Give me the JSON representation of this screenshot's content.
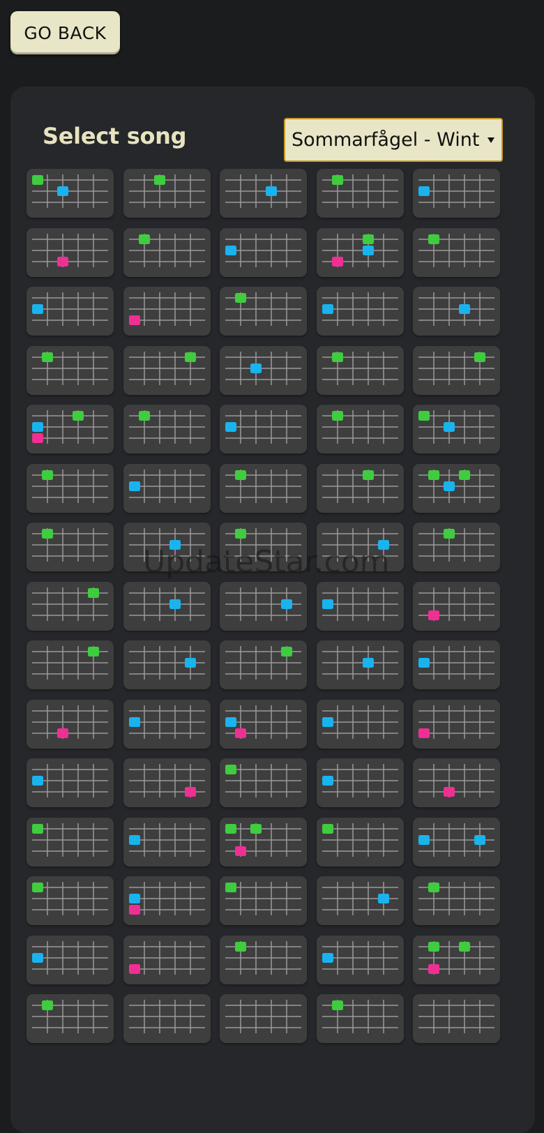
{
  "back_label": "GO BACK",
  "select_label": "Select song",
  "song_selected": "Sommarfågel - Wint",
  "watermark": "UpdateStar.com",
  "note_colors": {
    "g": "#3fcc3f",
    "b": "#19b3ee",
    "p": "#ef2f93"
  },
  "rows": [
    [
      [
        [
          "g",
          0,
          0
        ],
        [
          "b",
          2,
          1
        ]
      ],
      [
        [
          "g",
          2,
          0
        ]
      ],
      [
        [
          "b",
          3,
          1
        ]
      ],
      [
        [
          "g",
          1,
          0
        ]
      ],
      [
        [
          "b",
          0,
          1
        ]
      ]
    ],
    [
      [
        [
          "p",
          2,
          2
        ]
      ],
      [
        [
          "g",
          1,
          0
        ]
      ],
      [
        [
          "b",
          0,
          1
        ]
      ],
      [
        [
          "g",
          3,
          0
        ],
        [
          "b",
          3,
          1
        ],
        [
          "p",
          1,
          2
        ]
      ],
      [
        [
          "g",
          1,
          0
        ]
      ]
    ],
    [
      [
        [
          "b",
          0,
          1
        ]
      ],
      [
        [
          "p",
          0,
          2
        ]
      ],
      [
        [
          "g",
          1,
          0
        ]
      ],
      [
        [
          "b",
          0,
          1
        ]
      ],
      [
        [
          "b",
          3,
          1
        ]
      ]
    ],
    [
      [
        [
          "g",
          1,
          0
        ]
      ],
      [
        [
          "g",
          4,
          0
        ]
      ],
      [
        [
          "b",
          2,
          1
        ]
      ],
      [
        [
          "g",
          1,
          0
        ]
      ],
      [
        [
          "g",
          4,
          0
        ]
      ]
    ],
    [
      [
        [
          "g",
          3,
          0
        ],
        [
          "b",
          0,
          1
        ],
        [
          "p",
          0,
          2
        ]
      ],
      [
        [
          "g",
          1,
          0
        ]
      ],
      [
        [
          "b",
          0,
          1
        ]
      ],
      [
        [
          "g",
          1,
          0
        ]
      ],
      [
        [
          "g",
          0,
          0
        ],
        [
          "b",
          2,
          1
        ]
      ]
    ],
    [
      [
        [
          "g",
          1,
          0
        ]
      ],
      [
        [
          "b",
          0,
          1
        ]
      ],
      [
        [
          "g",
          1,
          0
        ]
      ],
      [
        [
          "g",
          3,
          0
        ]
      ],
      [
        [
          "g",
          1,
          0
        ],
        [
          "g",
          3,
          0
        ],
        [
          "b",
          2,
          1
        ]
      ]
    ],
    [
      [
        [
          "g",
          1,
          0
        ]
      ],
      [
        [
          "b",
          3,
          1
        ]
      ],
      [
        [
          "g",
          1,
          0
        ]
      ],
      [
        [
          "b",
          4,
          1
        ]
      ],
      [
        [
          "g",
          2,
          0
        ]
      ]
    ],
    [
      [
        [
          "g",
          4,
          0
        ]
      ],
      [
        [
          "b",
          3,
          1
        ]
      ],
      [
        [
          "b",
          4,
          1
        ]
      ],
      [
        [
          "b",
          0,
          1
        ]
      ],
      [
        [
          "p",
          1,
          2
        ]
      ]
    ],
    [
      [
        [
          "g",
          4,
          0
        ]
      ],
      [
        [
          "b",
          4,
          1
        ]
      ],
      [
        [
          "g",
          4,
          0
        ]
      ],
      [
        [
          "b",
          3,
          1
        ]
      ],
      [
        [
          "b",
          0,
          1
        ]
      ]
    ],
    [
      [
        [
          "p",
          2,
          2
        ]
      ],
      [
        [
          "b",
          0,
          1
        ]
      ],
      [
        [
          "b",
          0,
          1
        ],
        [
          "p",
          1,
          2
        ]
      ],
      [
        [
          "b",
          0,
          1
        ]
      ],
      [
        [
          "p",
          0,
          2
        ]
      ]
    ],
    [
      [
        [
          "b",
          0,
          1
        ]
      ],
      [
        [
          "p",
          4,
          2
        ]
      ],
      [
        [
          "g",
          0,
          0
        ]
      ],
      [
        [
          "b",
          0,
          1
        ]
      ],
      [
        [
          "p",
          2,
          2
        ]
      ]
    ],
    [
      [
        [
          "g",
          0,
          0
        ]
      ],
      [
        [
          "b",
          0,
          1
        ]
      ],
      [
        [
          "g",
          0,
          0
        ],
        [
          "g",
          2,
          0
        ],
        [
          "p",
          1,
          2
        ]
      ],
      [
        [
          "g",
          0,
          0
        ]
      ],
      [
        [
          "b",
          0,
          1
        ],
        [
          "b",
          4,
          1
        ]
      ]
    ],
    [
      [
        [
          "g",
          0,
          0
        ]
      ],
      [
        [
          "b",
          0,
          1
        ],
        [
          "p",
          0,
          2
        ]
      ],
      [
        [
          "g",
          0,
          0
        ]
      ],
      [
        [
          "b",
          4,
          1
        ]
      ],
      [
        [
          "g",
          1,
          0
        ]
      ]
    ],
    [
      [
        [
          "b",
          0,
          1
        ]
      ],
      [
        [
          "p",
          0,
          2
        ]
      ],
      [
        [
          "g",
          1,
          0
        ]
      ],
      [
        [
          "b",
          0,
          1
        ]
      ],
      [
        [
          "g",
          1,
          0
        ],
        [
          "g",
          3,
          0
        ],
        [
          "p",
          1,
          2
        ]
      ]
    ],
    [
      [
        [
          "g",
          1,
          0
        ]
      ],
      [],
      [],
      [
        [
          "g",
          1,
          0
        ]
      ],
      []
    ]
  ]
}
